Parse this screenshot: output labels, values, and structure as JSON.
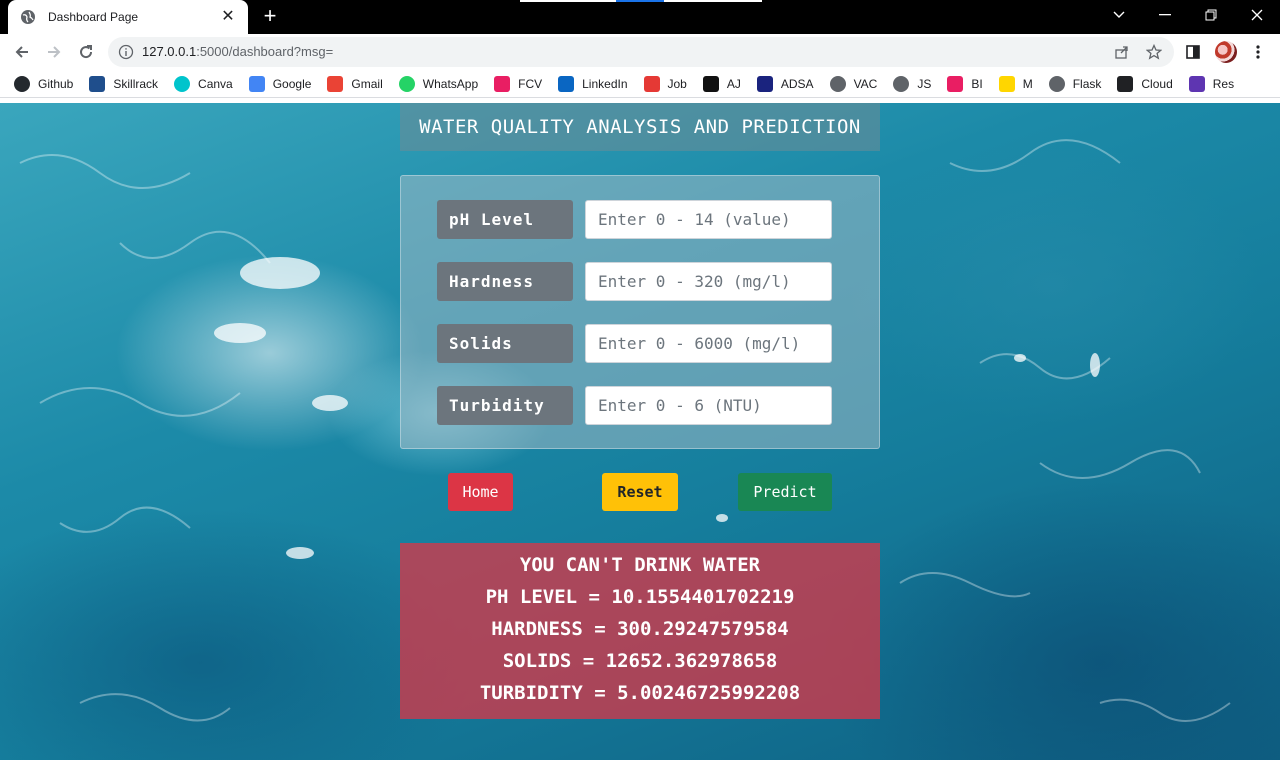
{
  "browser": {
    "tab_title": "Dashboard Page",
    "new_tab_symbol": "+",
    "url_host": "127.0.0.1",
    "url_rest": ":5000/dashboard?msg=",
    "bookmarks": [
      {
        "label": "Github",
        "icon": "github-icon",
        "color": "#24292e"
      },
      {
        "label": "Skillrack",
        "icon": "skillrack-icon",
        "color": "#1f4e8c"
      },
      {
        "label": "Canva",
        "icon": "canva-icon",
        "color": "#00c4cc"
      },
      {
        "label": "Google",
        "icon": "google-icon",
        "color": "#4285f4"
      },
      {
        "label": "Gmail",
        "icon": "gmail-icon",
        "color": "#ea4335"
      },
      {
        "label": "WhatsApp",
        "icon": "whatsapp-icon",
        "color": "#25d366"
      },
      {
        "label": "FCV",
        "icon": "fcv-icon",
        "color": "#e91e63"
      },
      {
        "label": "LinkedIn",
        "icon": "linkedin-icon",
        "color": "#0a66c2"
      },
      {
        "label": "Job",
        "icon": "job-icon",
        "color": "#e53935"
      },
      {
        "label": "AJ",
        "icon": "amazon-icon",
        "color": "#111111"
      },
      {
        "label": "ADSA",
        "icon": "adsa-icon",
        "color": "#1a237e"
      },
      {
        "label": "VAC",
        "icon": "globe-icon",
        "color": "#5f6368"
      },
      {
        "label": "JS",
        "icon": "globe-icon",
        "color": "#5f6368"
      },
      {
        "label": "BI",
        "icon": "bi-icon",
        "color": "#e91e63"
      },
      {
        "label": "M",
        "icon": "m-icon",
        "color": "#ffd600"
      },
      {
        "label": "Flask",
        "icon": "globe-icon",
        "color": "#5f6368"
      },
      {
        "label": "Cloud",
        "icon": "cloud-icon",
        "color": "#202124"
      },
      {
        "label": "Res",
        "icon": "res-icon",
        "color": "#5e35b1"
      }
    ]
  },
  "page": {
    "title": "WATER QUALITY ANALYSIS AND PREDICTION",
    "fields": [
      {
        "label": "pH Level",
        "placeholder": "Enter 0 - 14 (value)",
        "value": ""
      },
      {
        "label": "Hardness",
        "placeholder": "Enter 0 - 320 (mg/l)",
        "value": ""
      },
      {
        "label": "Solids",
        "placeholder": "Enter 0 - 6000 (mg/l)",
        "value": ""
      },
      {
        "label": "Turbidity",
        "placeholder": "Enter 0 - 6 (NTU)",
        "value": ""
      }
    ],
    "buttons": {
      "home": "Home",
      "reset": "Reset",
      "predict": "Predict"
    },
    "result": {
      "verdict": "YOU CAN'T DRINK WATER",
      "ph": "PH LEVEL = 10.1554401702219",
      "hardness": "HARDNESS = 300.29247579584",
      "solids": "SOLIDS = 12652.362978658",
      "turbidity": "TURBIDITY = 5.00246725992208"
    }
  },
  "colors": {
    "danger": "#dc3545",
    "warning": "#ffc107",
    "success": "#198754",
    "label_gray": "#6c757d"
  }
}
